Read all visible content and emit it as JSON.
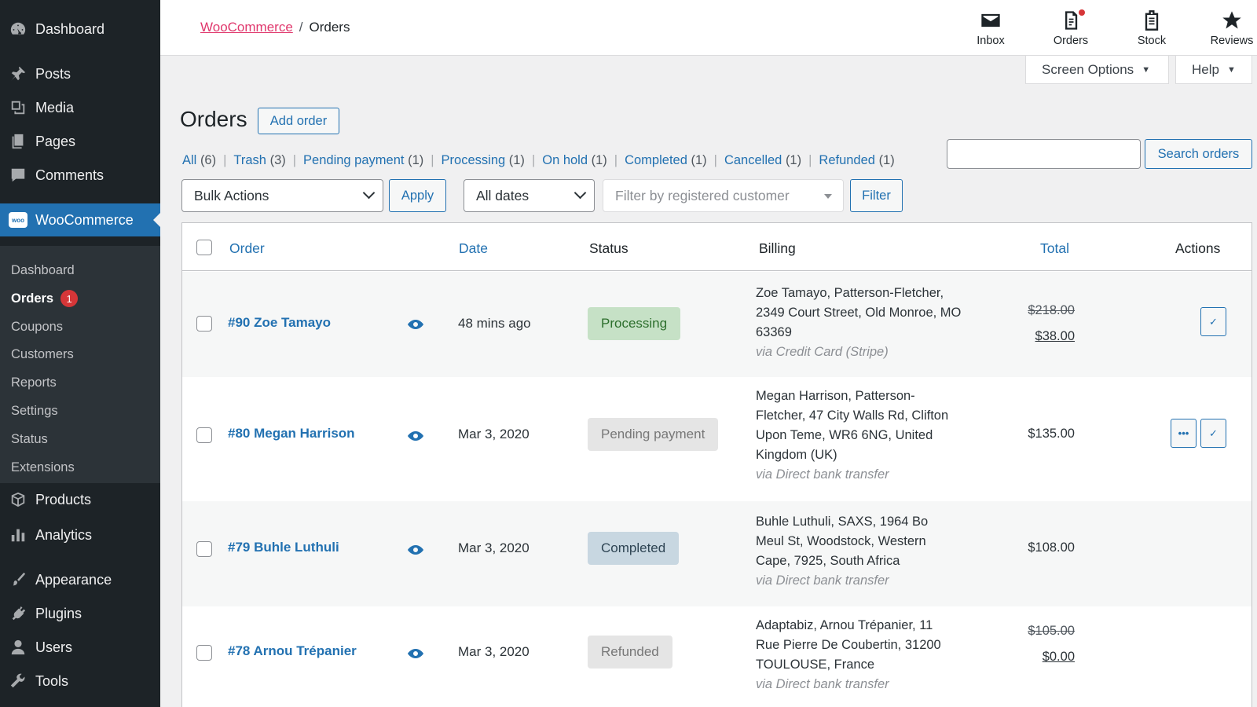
{
  "sidebar": {
    "items": [
      {
        "label": "Dashboard",
        "icon": "dashboard-icon"
      },
      {
        "label": "Posts",
        "icon": "pushpin-icon"
      },
      {
        "label": "Media",
        "icon": "media-icon"
      },
      {
        "label": "Pages",
        "icon": "pages-icon"
      },
      {
        "label": "Comments",
        "icon": "comment-icon"
      },
      {
        "label": "WooCommerce",
        "icon": "woo-logo-icon",
        "logo_text": "woo"
      },
      {
        "label": "Products",
        "icon": "box-icon"
      },
      {
        "label": "Analytics",
        "icon": "bar-chart-icon"
      },
      {
        "label": "Appearance",
        "icon": "brush-icon"
      },
      {
        "label": "Plugins",
        "icon": "plug-icon"
      },
      {
        "label": "Users",
        "icon": "user-icon"
      },
      {
        "label": "Tools",
        "icon": "wrench-icon"
      }
    ],
    "submenu": [
      {
        "label": "Dashboard"
      },
      {
        "label": "Orders",
        "badge": "1"
      },
      {
        "label": "Coupons"
      },
      {
        "label": "Customers"
      },
      {
        "label": "Reports"
      },
      {
        "label": "Settings"
      },
      {
        "label": "Status"
      },
      {
        "label": "Extensions"
      }
    ]
  },
  "header": {
    "breadcrumb_root": "WooCommerce",
    "breadcrumb_sep": "/",
    "breadcrumb_current": "Orders",
    "tools": [
      {
        "label": "Inbox",
        "icon": "inbox-icon"
      },
      {
        "label": "Orders",
        "icon": "orders-clipboard-icon"
      },
      {
        "label": "Stock",
        "icon": "stock-clipboard-icon"
      },
      {
        "label": "Reviews",
        "icon": "star-icon"
      }
    ],
    "screen_options": "Screen Options",
    "help": "Help"
  },
  "page": {
    "title": "Orders",
    "add_button": "Add order",
    "status_links": [
      {
        "label": "All",
        "count": "(6)"
      },
      {
        "label": "Trash",
        "count": "(3)"
      },
      {
        "label": "Pending payment",
        "count": "(1)"
      },
      {
        "label": "Processing",
        "count": "(1)"
      },
      {
        "label": "On hold",
        "count": "(1)"
      },
      {
        "label": "Completed",
        "count": "(1)"
      },
      {
        "label": "Cancelled",
        "count": "(1)"
      },
      {
        "label": "Refunded",
        "count": "(1)"
      }
    ],
    "search_placeholder": "",
    "search_button": "Search orders",
    "bulk_actions": "Bulk Actions",
    "apply": "Apply",
    "dates": "All dates",
    "customer_filter_placeholder": "Filter by registered customer",
    "filter": "Filter"
  },
  "table": {
    "columns": {
      "order": "Order",
      "date": "Date",
      "status": "Status",
      "billing": "Billing",
      "total": "Total",
      "actions": "Actions"
    },
    "rows": [
      {
        "order": "#90 Zoe Tamayo",
        "date": "48 mins ago",
        "status": "Processing",
        "status_class": "processing",
        "billing_address": "Zoe Tamayo, Patterson-Fletcher, 2349 Court Street, Old Monroe, MO 63369",
        "billing_via": "via Credit Card (Stripe)",
        "total_old": "$218.00",
        "total": "$38.00",
        "actions": [
          "complete"
        ]
      },
      {
        "order": "#80 Megan Harrison",
        "date": "Mar 3, 2020",
        "status": "Pending payment",
        "status_class": "pending",
        "billing_address": "Megan Harrison, Patterson-Fletcher, 47 City Walls Rd, Clifton Upon Teme, WR6 6NG, United Kingdom (UK)",
        "billing_via": "via Direct bank transfer",
        "total_old": "",
        "total": "$135.00",
        "actions": [
          "processing",
          "complete"
        ]
      },
      {
        "order": "#79 Buhle Luthuli",
        "date": "Mar 3, 2020",
        "status": "Completed",
        "status_class": "completed",
        "billing_address": "Buhle Luthuli, SAXS, 1964 Bo Meul St, Woodstock, Western Cape, 7925, South Africa",
        "billing_via": "via Direct bank transfer",
        "total_old": "",
        "total": "$108.00",
        "actions": []
      },
      {
        "order": "#78 Arnou Trépanier",
        "date": "Mar 3, 2020",
        "status": "Refunded",
        "status_class": "refunded",
        "billing_address": "Adaptabiz, Arnou Trépanier, 11 Rue Pierre De Coubertin, 31200 TOULOUSE, France",
        "billing_via": "via Direct bank transfer",
        "total_old": "$105.00",
        "total": "$0.00",
        "actions": []
      }
    ]
  },
  "colors": {
    "sidebar_bg": "#1d2327",
    "accent": "#2271b1",
    "woo_pink": "#e0386d",
    "badge_red": "#d63638"
  }
}
